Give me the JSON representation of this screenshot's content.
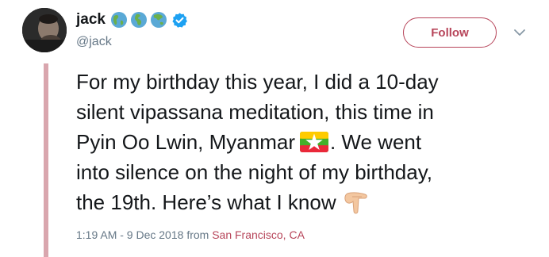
{
  "user": {
    "display_name": "jack",
    "handle": "@jack",
    "name_emoji": [
      "globe-americas-icon",
      "globe-europe-africa-icon",
      "globe-asia-australia-icon"
    ],
    "verified": true
  },
  "follow_button": {
    "label": "Follow"
  },
  "tweet": {
    "lines": [
      "For my birthday this year, I did a 10-day",
      "silent vipassana meditation, this time in",
      "Pyin Oo Lwin, Myanmar",
      ". We went",
      "into silence on the night of my birthday,",
      "the 19th. Here’s what I know"
    ],
    "inline_emoji": [
      "myanmar-flag-icon",
      "backhand-index-pointing-down-icon"
    ]
  },
  "meta": {
    "timestamp": "1:19 AM - 9 Dec 2018",
    "from_label": "from",
    "location": "San Francisco, CA"
  },
  "colors": {
    "accent": "#b7455a",
    "thread_line": "#d9a6ae",
    "verified_blue": "#1da1f2",
    "text": "#14171a",
    "secondary_text": "#657786"
  }
}
